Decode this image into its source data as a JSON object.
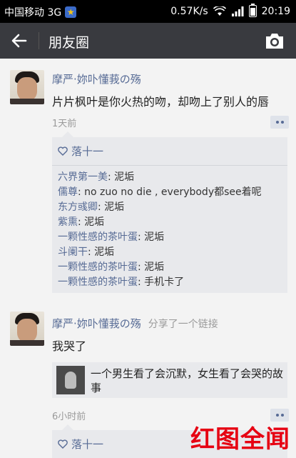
{
  "status_bar": {
    "carrier": "中国移动 3G",
    "speed": "0.57K/s",
    "time": "20:19"
  },
  "nav": {
    "title": "朋友圈",
    "back_icon": "arrow-left-icon",
    "camera_icon": "camera-icon"
  },
  "posts": [
    {
      "nickname": "摩严·妳卟懂莪の殇",
      "text": "片片枫叶是你火热的吻，却吻上了别人的唇",
      "time": "1天前",
      "likes": "落十一",
      "comments": [
        {
          "who": "六界第一美",
          "text": "泥垢"
        },
        {
          "who": "儒尊",
          "text": "no zuo no die , everybody都see着呢"
        },
        {
          "who": "东方彧卿",
          "text": "泥垢"
        },
        {
          "who": "紫熏",
          "text": "泥垢"
        },
        {
          "who": "一颗性感的茶叶蛋",
          "text": "泥垢"
        },
        {
          "who": "斗阑干",
          "text": "泥垢"
        },
        {
          "who": "一颗性感的茶叶蛋",
          "text": "泥垢"
        },
        {
          "who": "一颗性感的茶叶蛋",
          "text": "手机卡了"
        }
      ]
    },
    {
      "nickname": "摩严·妳卟懂莪の殇",
      "share_text": "分享了一个链接",
      "text": "我哭了",
      "link_title": "一个男生看了会沉默，女生看了会哭的故事",
      "time": "6小时前",
      "likes": "落十一"
    }
  ],
  "watermark": "红图全闻",
  "colors": {
    "nickname": "#576b95",
    "navbar": "#393a3f",
    "comment_bg": "#e8e9ec",
    "watermark": "#e60012"
  }
}
